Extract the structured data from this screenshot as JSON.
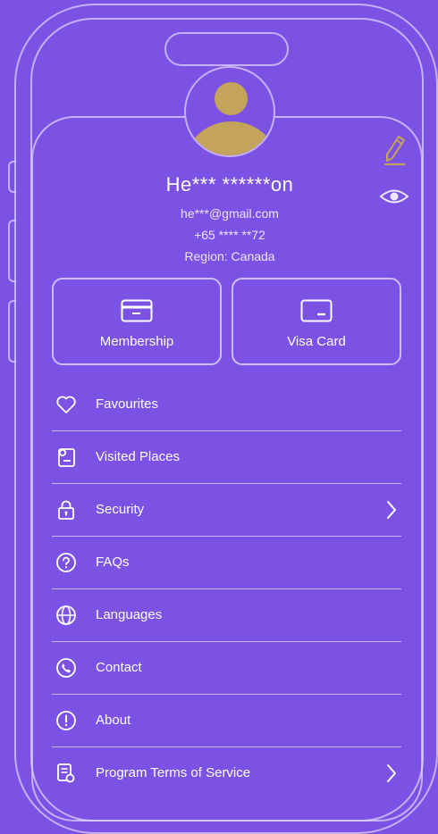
{
  "profile": {
    "name": "He*** ******on",
    "email": "he***@gmail.com",
    "phone": "+65 **** **72",
    "region": "Region: Canada"
  },
  "cards": [
    {
      "label": "Membership",
      "icon": "credit-card-icon"
    },
    {
      "label": "Visa Card",
      "icon": "card-icon"
    }
  ],
  "menu": {
    "items": [
      {
        "label": "Favourites",
        "icon": "heart-icon"
      },
      {
        "label": "Visited Places",
        "icon": "map-pin-icon"
      },
      {
        "label": "Security",
        "icon": "lock-icon",
        "chevron": true
      },
      {
        "label": "FAQs",
        "icon": "question-icon"
      },
      {
        "label": "Languages",
        "icon": "globe-icon"
      },
      {
        "label": "Contact",
        "icon": "phone-icon"
      },
      {
        "label": "About",
        "icon": "info-icon"
      },
      {
        "label": "Program Terms of Service",
        "icon": "document-icon",
        "chevron": true
      }
    ]
  },
  "colors": {
    "background": "#7b52e3",
    "accent": "#c4a45a",
    "outline": "#dcd2ff"
  }
}
